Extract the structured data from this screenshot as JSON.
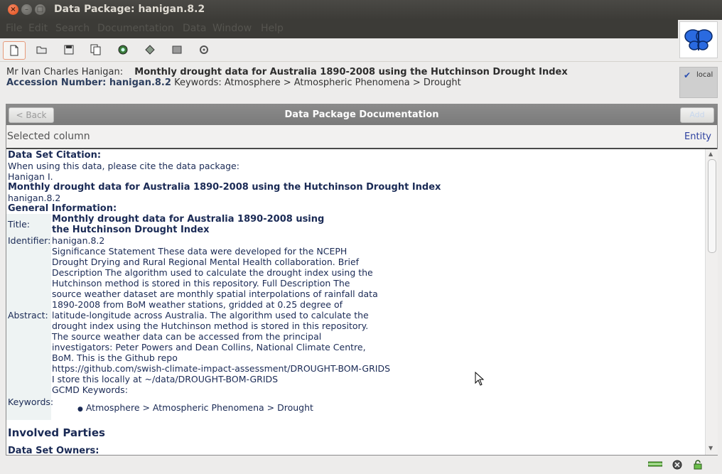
{
  "window": {
    "title": "Data Package: hanigan.8.2"
  },
  "menu": [
    "File",
    "Edit",
    "Search",
    "Documentation",
    "Data",
    "Window",
    "Help"
  ],
  "header": {
    "owner": "Mr Ivan Charles Hanigan:",
    "title": "Monthly drought data for Australia 1890-2008 using the Hutchinson Drought Index",
    "accession_label": "Accession Number: hanigan.8.2",
    "keywords_line": "Keywords: Atmosphere > Atmospheric Phenomena > Drought",
    "location_label": "local"
  },
  "panel": {
    "back_label": "< Back",
    "title": "Data Package Documentation",
    "add_label": "Add",
    "selected_label": "Selected column",
    "entity_link": "Entity"
  },
  "doc": {
    "citation_heading": "Data Set Citation:",
    "cite_instruction": "When using this data, please cite the data package:",
    "author": "Hanigan I.",
    "citation_title": "Monthly drought data for Australia 1890-2008 using the Hutchinson Drought Index",
    "citation_id": "hanigan.8.2",
    "general_heading": "General Information:",
    "title_label": "Title:",
    "title_value": "Monthly drought data for Australia 1890-2008 using the Hutchinson Drought Index",
    "identifier_label": "Identifier:",
    "identifier_value": "hanigan.8.2",
    "abstract_label": "Abstract:",
    "abstract_lines": [
      "Significance Statement These data were developed for the NCEPH",
      "Drought Drying and Rural Regional Mental Health collaboration. Brief",
      "Description The algorithm used to calculate the drought index using the",
      "Hutchinson method is stored in this repository. Full Description The",
      "source weather dataset are monthly spatial interpolations of rainfall data",
      "1890-2008 from BoM weather stations, gridded at 0.25 degree of",
      "latitude-longitude across Australia. The algorithm used to calculate the",
      "drought index using the Hutchinson method is stored in this repository.",
      "The source weather data can be accessed from the principal",
      "investigators: Peter Powers and Dean Collins, National Climate Centre,",
      "BoM. This is the Github repo",
      "https://github.com/swish-climate-impact-assessment/DROUGHT-BOM-GRIDS",
      "I store this locally at ~/data/DROUGHT-BOM-GRIDS",
      "GCMD Keywords:"
    ],
    "keywords_label": "Keywords:",
    "keyword_item": "Atmosphere > Atmospheric Phenomena > Drought",
    "involved_heading": "Involved Parties",
    "owners_heading": "Data Set Owners:"
  },
  "icons": [
    "new-icon",
    "open-icon",
    "save-icon",
    "copy-icon",
    "search-data-icon",
    "synchronize-icon",
    "export-icon",
    "settings-icon"
  ]
}
